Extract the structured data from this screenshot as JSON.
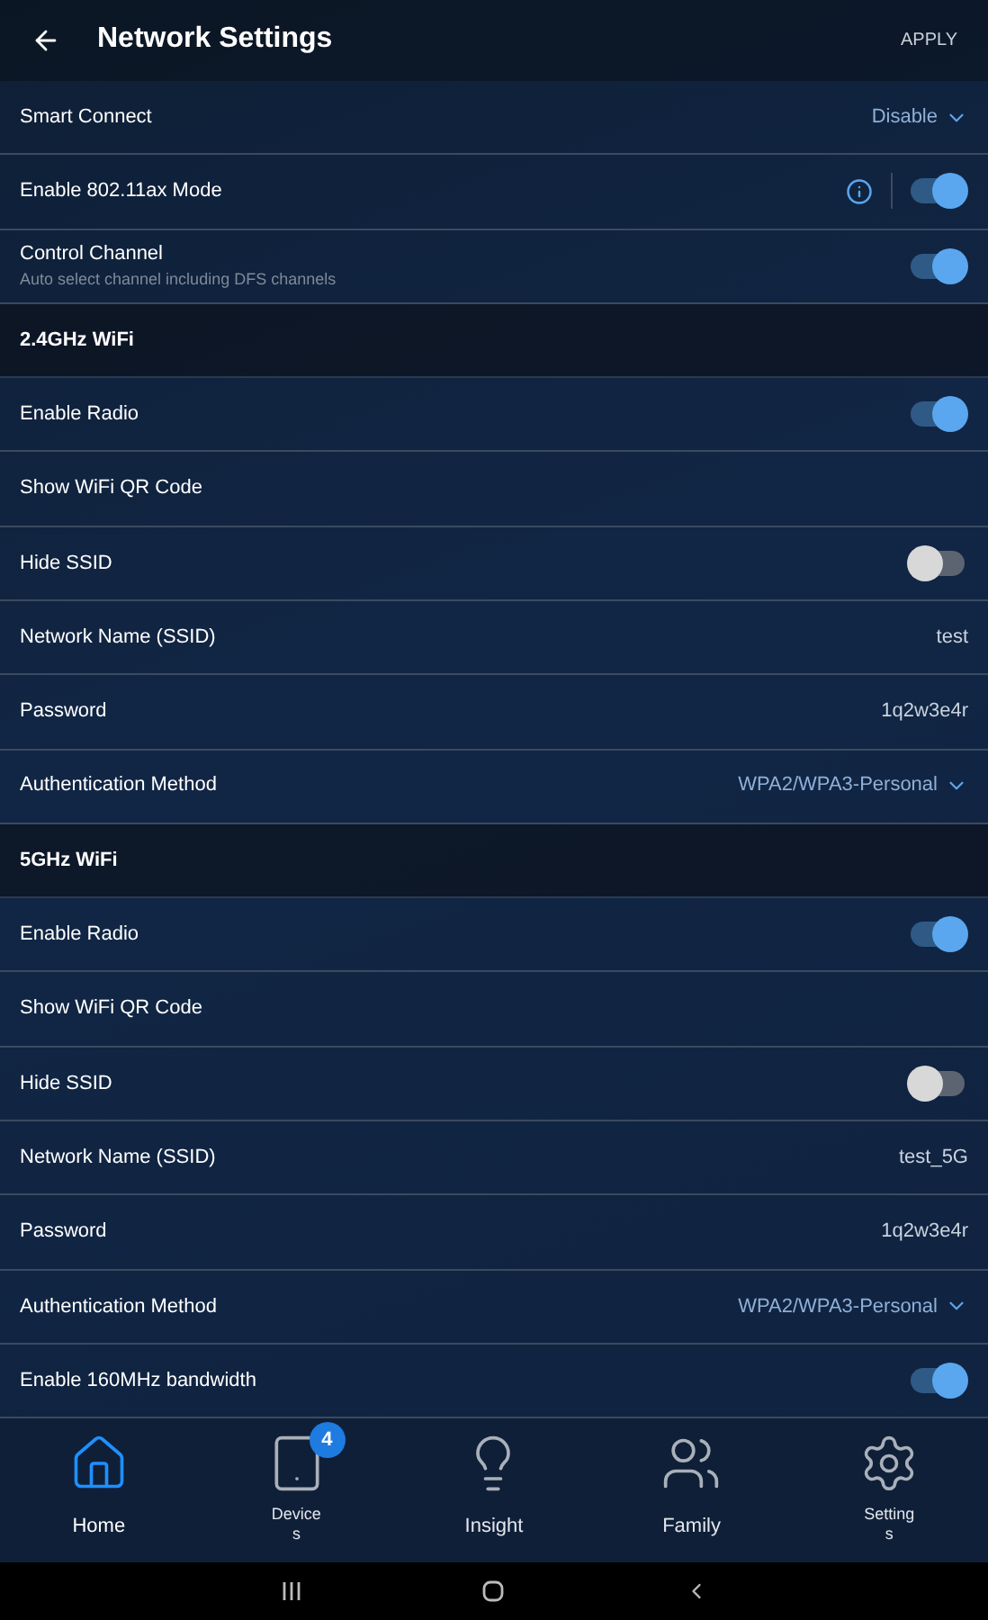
{
  "header": {
    "title": "Network Settings",
    "action": "APPLY"
  },
  "rows": [
    {
      "kind": "dropdown",
      "label": "Smart Connect",
      "value": "Disable"
    },
    {
      "kind": "toggle",
      "label": "Enable 802.11ax Mode",
      "on": true,
      "info": true
    },
    {
      "kind": "toggle",
      "label": "Control Channel",
      "sublabel": "Auto select channel including DFS channels",
      "on": true
    },
    {
      "kind": "section",
      "label": "2.4GHz WiFi"
    },
    {
      "kind": "toggle",
      "label": "Enable Radio",
      "on": true
    },
    {
      "kind": "link",
      "label": "Show WiFi QR Code"
    },
    {
      "kind": "toggle",
      "label": "Hide SSID",
      "on": false
    },
    {
      "kind": "text",
      "label": "Network Name (SSID)",
      "value": "test"
    },
    {
      "kind": "text",
      "label": "Password",
      "value": "1q2w3e4r"
    },
    {
      "kind": "dropdown",
      "label": "Authentication Method",
      "value": "WPA2/WPA3-Personal"
    },
    {
      "kind": "section",
      "label": "5GHz WiFi"
    },
    {
      "kind": "toggle",
      "label": "Enable Radio",
      "on": true
    },
    {
      "kind": "link",
      "label": "Show WiFi QR Code"
    },
    {
      "kind": "toggle",
      "label": "Hide SSID",
      "on": false
    },
    {
      "kind": "text",
      "label": "Network Name (SSID)",
      "value": "test_5G"
    },
    {
      "kind": "text",
      "label": "Password",
      "value": "1q2w3e4r"
    },
    {
      "kind": "dropdown",
      "label": "Authentication Method",
      "value": "WPA2/WPA3-Personal"
    },
    {
      "kind": "toggle",
      "label": "Enable 160MHz bandwidth",
      "on": true
    }
  ],
  "nav": [
    {
      "kind": "home",
      "label": "Home",
      "selected": true
    },
    {
      "kind": "devices",
      "label": "Devices",
      "badge": "4",
      "selected": false,
      "wrap": true
    },
    {
      "kind": "insight",
      "label": "Insight",
      "selected": false
    },
    {
      "kind": "family",
      "label": "Family",
      "selected": false
    },
    {
      "kind": "settings",
      "label": "Settings",
      "selected": false,
      "wrap": true
    }
  ]
}
